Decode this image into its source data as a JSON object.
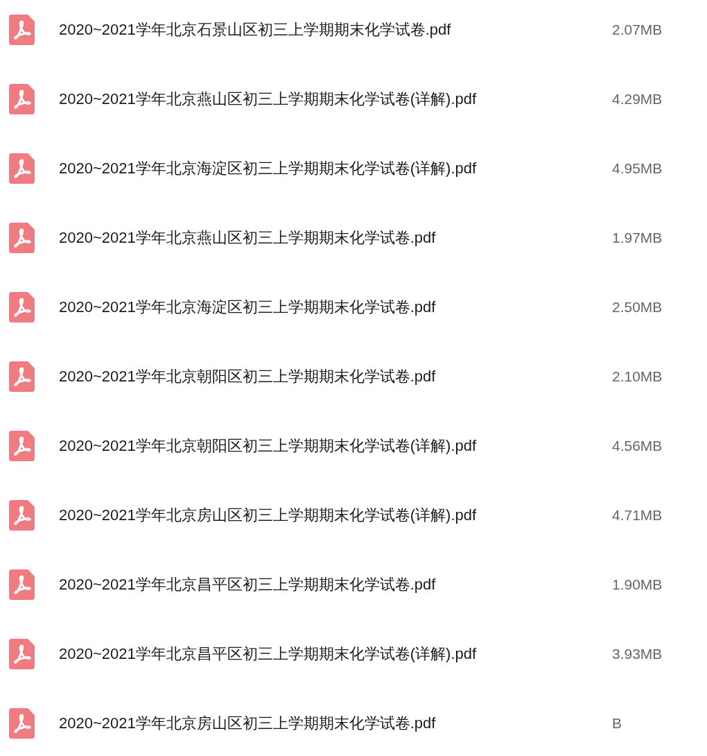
{
  "files": [
    {
      "name": "2020~2021学年北京石景山区初三上学期期末化学试卷.pdf",
      "size": "2.07MB"
    },
    {
      "name": "2020~2021学年北京燕山区初三上学期期末化学试卷(详解).pdf",
      "size": "4.29MB"
    },
    {
      "name": "2020~2021学年北京海淀区初三上学期期末化学试卷(详解).pdf",
      "size": "4.95MB"
    },
    {
      "name": "2020~2021学年北京燕山区初三上学期期末化学试卷.pdf",
      "size": "1.97MB"
    },
    {
      "name": "2020~2021学年北京海淀区初三上学期期末化学试卷.pdf",
      "size": "2.50MB"
    },
    {
      "name": "2020~2021学年北京朝阳区初三上学期期末化学试卷.pdf",
      "size": "2.10MB"
    },
    {
      "name": "2020~2021学年北京朝阳区初三上学期期末化学试卷(详解).pdf",
      "size": "4.56MB"
    },
    {
      "name": "2020~2021学年北京房山区初三上学期期末化学试卷(详解).pdf",
      "size": "4.71MB"
    },
    {
      "name": "2020~2021学年北京昌平区初三上学期期末化学试卷.pdf",
      "size": "1.90MB"
    },
    {
      "name": "2020~2021学年北京昌平区初三上学期期末化学试卷(详解).pdf",
      "size": "3.93MB"
    },
    {
      "name": "2020~2021学年北京房山区初三上学期期末化学试卷.pdf",
      "size": "B"
    }
  ]
}
